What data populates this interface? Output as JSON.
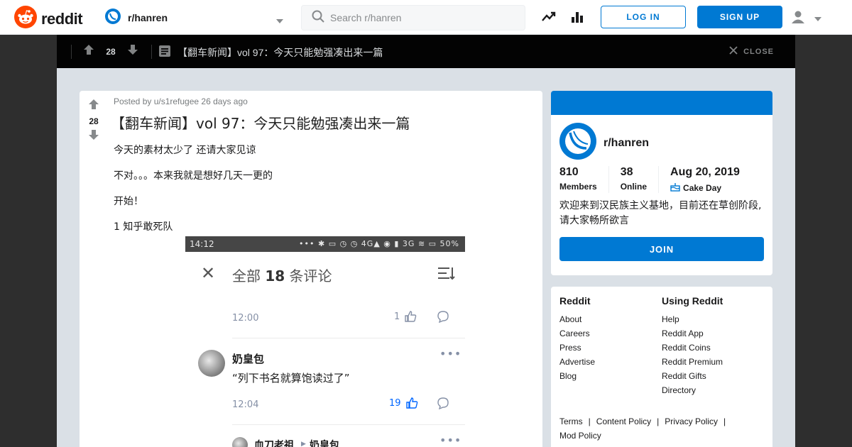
{
  "header": {
    "brand": "reddit",
    "community": "r/hanren",
    "search_placeholder": "Search r/hanren",
    "login": "LOG IN",
    "signup": "SIGN UP"
  },
  "post_bar": {
    "score": "28",
    "title": "【翻车新闻】vol 97：今天只能勉强凑出来一篇",
    "close": "CLOSE"
  },
  "post": {
    "score": "28",
    "meta": "Posted by u/s1refugee 26 days ago",
    "title": "【翻车新闻】vol 97：今天只能勉强凑出来一篇",
    "paragraphs": [
      "今天的素材太少了 还请大家见谅",
      "不对。。。本来我就是想好几天一更的",
      "开始！",
      "1 知乎敢死队"
    ]
  },
  "screenshot": {
    "status_time": "14:12",
    "status_icons": "••• ✱ ▭ ◷ ◷ 4G▲ ◉ ▮ 3G ≋ ▭ 50%",
    "header_prefix": "全部 ",
    "header_count": "18",
    "header_suffix": " 条评论",
    "c1_time": "12:00",
    "c1_likes": "1",
    "c2_name": "奶皇包",
    "c2_text": "“列下书名就算饱读过了”",
    "c2_time": "12:04",
    "c2_likes": "19",
    "c3_name": "血刀老祖",
    "c3_reply_to": "奶皇包",
    "dots": "•••"
  },
  "sidebar": {
    "name": "r/hanren",
    "members_num": "810",
    "members_label": "Members",
    "online_num": "38",
    "online_label": "Online",
    "cake_num": "Aug 20, 2019",
    "cake_label": "Cake Day",
    "description": "欢迎来到汉民族主义基地，目前还在草创阶段,请大家畅所欲言",
    "join": "JOIN"
  },
  "footer_links": {
    "col1_title": "Reddit",
    "col1": [
      "About",
      "Careers",
      "Press",
      "Advertise",
      "Blog"
    ],
    "col2_title": "Using Reddit",
    "col2": [
      "Help",
      "Reddit App",
      "Reddit Coins",
      "Reddit Premium",
      "Reddit Gifts",
      "Directory"
    ],
    "legal": [
      "Terms",
      "Content Policy",
      "Privacy Policy",
      "Mod Policy"
    ]
  },
  "colors": {
    "brand_orange": "#ff4500",
    "primary_blue": "#0079d3",
    "overlay_bg": "#dae0e6",
    "post_bar_bg": "#030303"
  }
}
